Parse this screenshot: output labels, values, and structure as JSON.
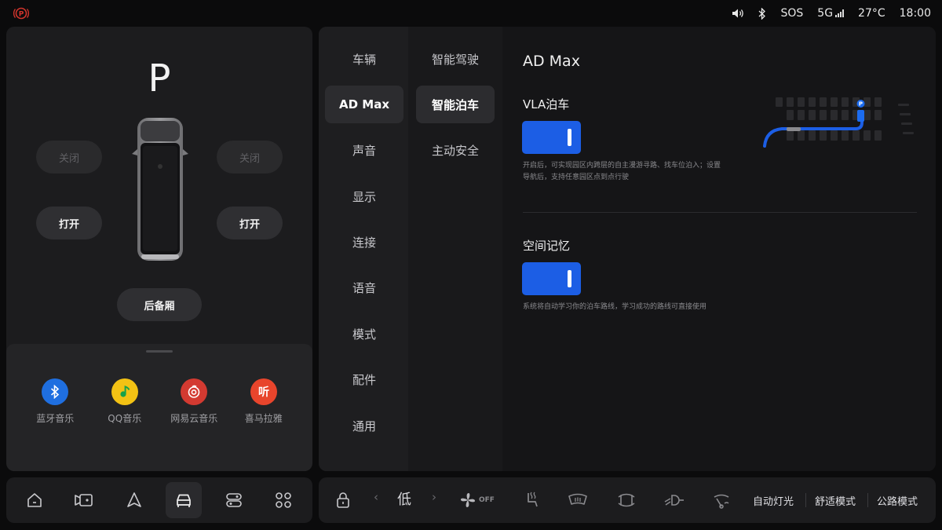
{
  "status_bar": {
    "parking_icon": "parking-brake-icon",
    "volume_icon": "volume-icon",
    "bluetooth_icon": "bluetooth-icon",
    "sos": "SOS",
    "network": "5G",
    "temperature": "27°C",
    "time": "18:00",
    "colors": {
      "parking_brake": "#d0342c"
    }
  },
  "car": {
    "gear": "P",
    "left_mirror_label": "关闭",
    "right_mirror_label": "关闭",
    "left_door_label": "打开",
    "right_door_label": "打开",
    "trunk_label": "后备厢"
  },
  "media": {
    "apps": [
      {
        "label": "蓝牙音乐",
        "icon": "bluetooth-icon",
        "color": "#1f6fe0"
      },
      {
        "label": "QQ音乐",
        "icon": "qq-music-icon",
        "color": "#f3c214"
      },
      {
        "label": "网易云音乐",
        "icon": "netease-music-icon",
        "color": "#d33a31"
      },
      {
        "label": "喜马拉雅",
        "icon": "ximalaya-icon",
        "color": "#e8452c"
      }
    ]
  },
  "settings": {
    "nav_primary": [
      {
        "label": "车辆"
      },
      {
        "label": "AD Max",
        "active": true
      },
      {
        "label": "声音"
      },
      {
        "label": "显示"
      },
      {
        "label": "连接"
      },
      {
        "label": "语音"
      },
      {
        "label": "模式"
      },
      {
        "label": "配件"
      },
      {
        "label": "通用"
      }
    ],
    "nav_secondary": [
      {
        "label": "智能驾驶"
      },
      {
        "label": "智能泊车",
        "active": true
      },
      {
        "label": "主动安全"
      }
    ],
    "title": "AD Max",
    "vla": {
      "title": "VLA泊车",
      "enabled": true,
      "desc": "开启后，可实现园区内跨层的自主漫游寻路、找车位泊入；设置导航后，支持任意园区点到点行驶"
    },
    "memory": {
      "title": "空间记忆",
      "enabled": true,
      "desc": "系统将自动学习你的泊车路线，学习成功的路线可直接使用"
    },
    "colors": {
      "toggle_on": "#1c5ee5"
    }
  },
  "dock": {
    "items": [
      "home-icon",
      "camera-icon",
      "navigation-icon",
      "car-icon",
      "controls-icon",
      "apps-grid-icon"
    ],
    "active_index": 3
  },
  "climate": {
    "lock_icon": "lock-icon",
    "fan_level": "低",
    "fan_status": "OFF",
    "quick_controls": [
      "seat-heat-icon",
      "rear-defrost-icon",
      "front-defrost-icon",
      "headlight-icon",
      "wiper-icon"
    ],
    "modes": [
      "自动灯光",
      "舒适模式",
      "公路模式"
    ]
  }
}
